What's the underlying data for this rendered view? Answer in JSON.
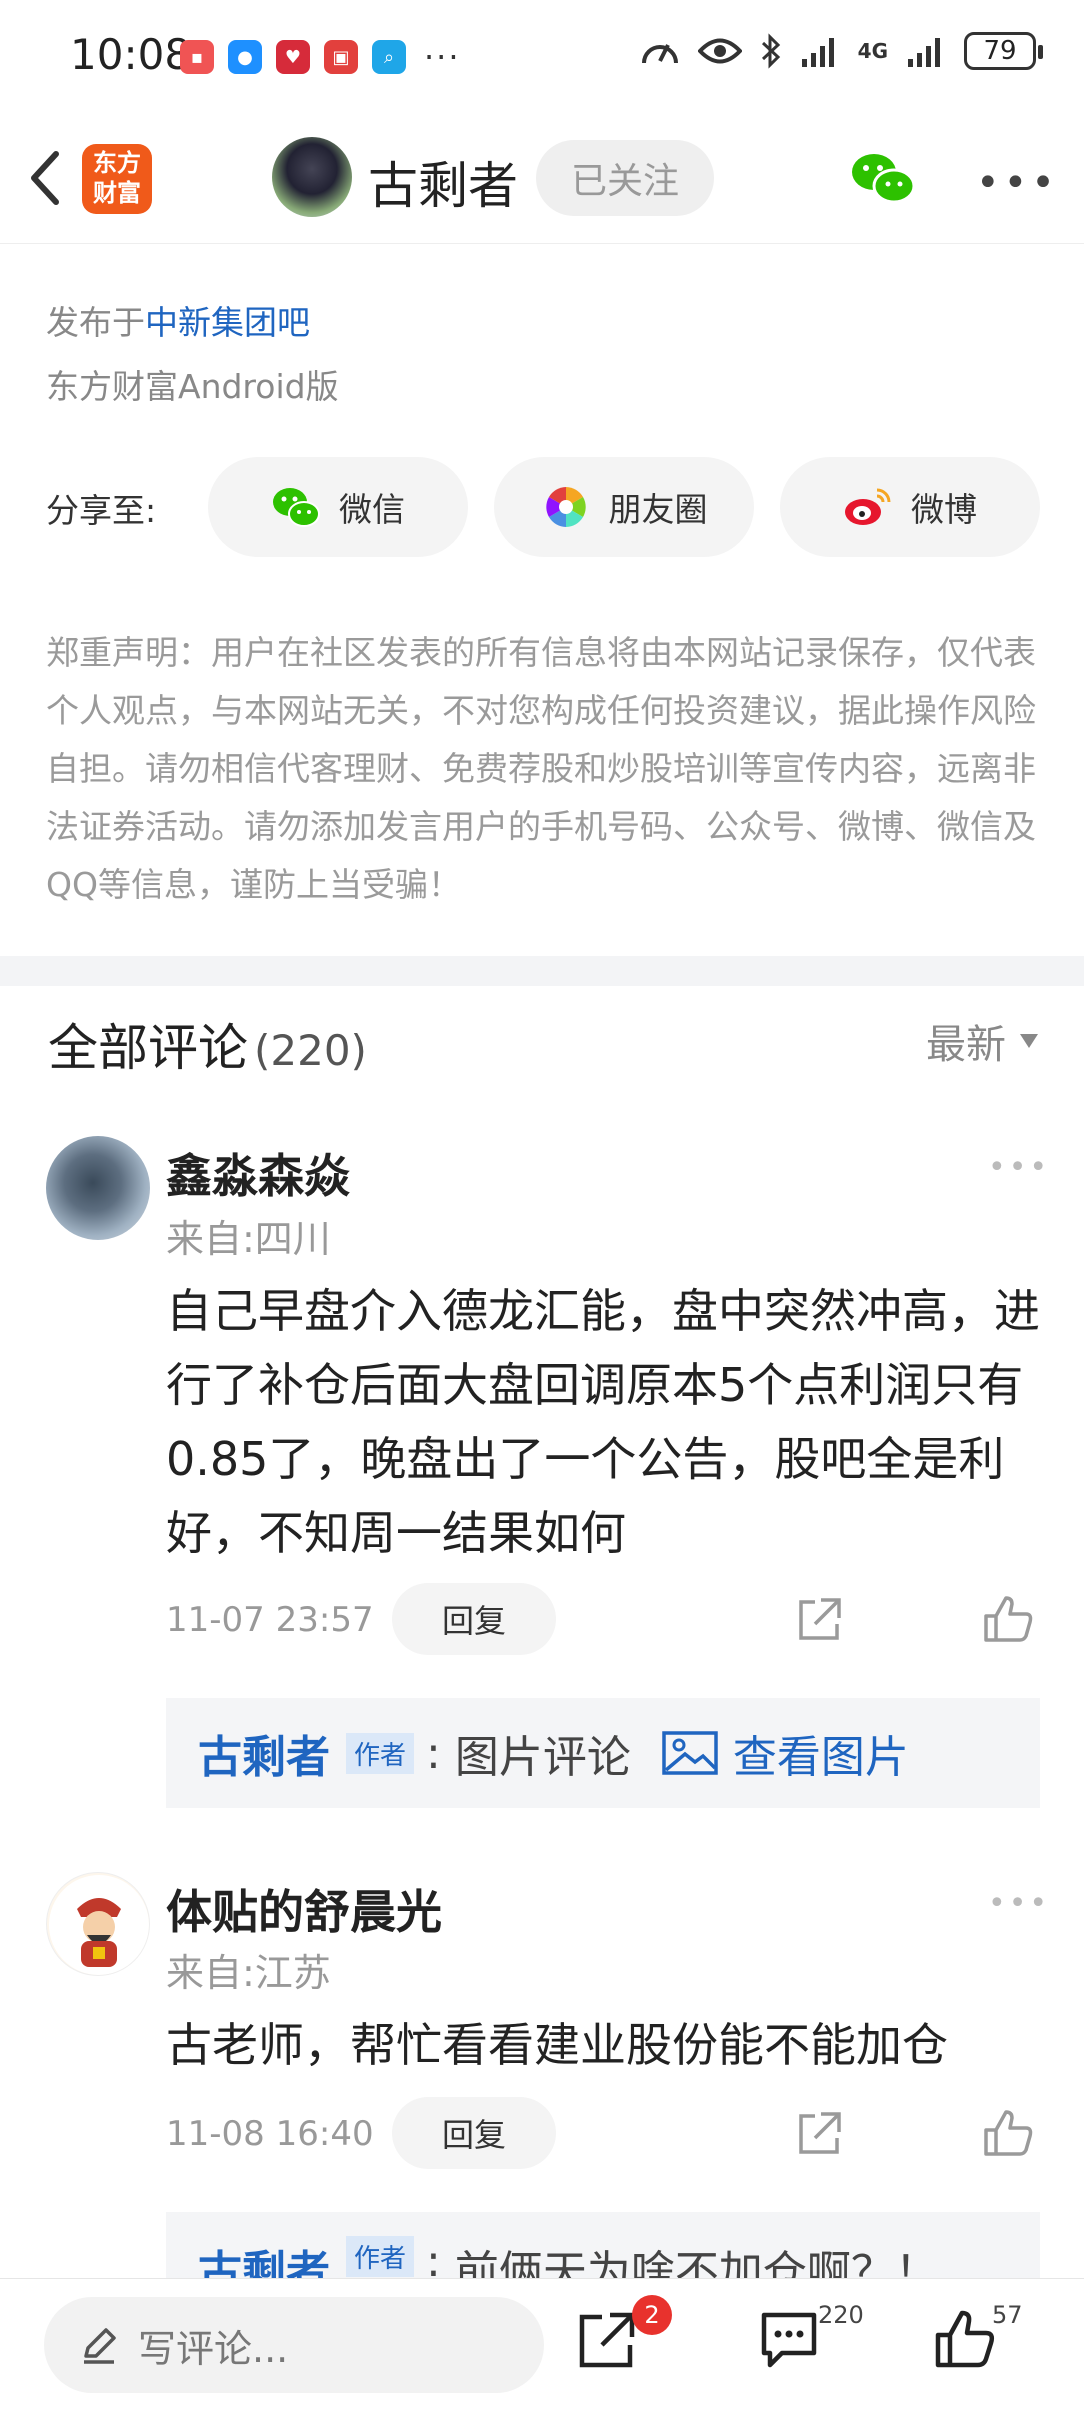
{
  "status_bar": {
    "time": "10:08",
    "battery": "79",
    "network": "4G"
  },
  "header": {
    "app_logo": "东方\n财富",
    "author_name": "古剩者",
    "follow_label": "已关注"
  },
  "post": {
    "posted_in_prefix": "发布于",
    "forum_name": "中新集团吧",
    "platform": "东方财富Android版"
  },
  "share": {
    "label": "分享至:",
    "options": [
      {
        "label": "微信",
        "icon": "wechat-icon"
      },
      {
        "label": "朋友圈",
        "icon": "moments-icon"
      },
      {
        "label": "微博",
        "icon": "weibo-icon"
      }
    ]
  },
  "disclaimer": "郑重声明：用户在社区发表的所有信息将由本网站记录保存，仅代表个人观点，与本网站无关，不对您构成任何投资建议，据此操作风险自担。请勿相信代客理财、免费荐股和炒股培训等宣传内容，远离非法证券活动。请勿添加发言用户的手机号码、公众号、微博、微信及QQ等信息，谨防上当受骗！",
  "comments_section": {
    "title": "全部评论",
    "count": "(220)",
    "sort_label": "最新"
  },
  "comments": [
    {
      "name": "鑫淼森焱",
      "location": "来自:四川",
      "text": "自己早盘介入德龙汇能，盘中突然冲高，进行了补仓后面大盘回调原本5个点利润只有0.85了，晚盘出了一个公告，股吧全是利好，不知周一结果如何",
      "time": "11-07 23:57",
      "reply_label": "回复",
      "sub_reply": {
        "who": "古剩者",
        "tag": "作者",
        "sep": ":",
        "text": "图片评论",
        "view_label": "查看图片"
      }
    },
    {
      "name": "体贴的舒晨光",
      "location": "来自:江苏",
      "text": "古老师，帮忙看看建业股份能不能加仓",
      "time": "11-08 16:40",
      "reply_label": "回复",
      "sub_reply": {
        "who": "古剩者",
        "tag": "作者",
        "sep": ":",
        "text": "前俩天为啥不加仓啊？！"
      }
    }
  ],
  "bottom_bar": {
    "write_placeholder": "写评论...",
    "share_badge": "2",
    "comment_count": "220",
    "like_count": "57"
  },
  "colors": {
    "link_blue": "#1f65c0",
    "brand_orange": "#f05a1a",
    "badge_red": "#e8322d"
  }
}
